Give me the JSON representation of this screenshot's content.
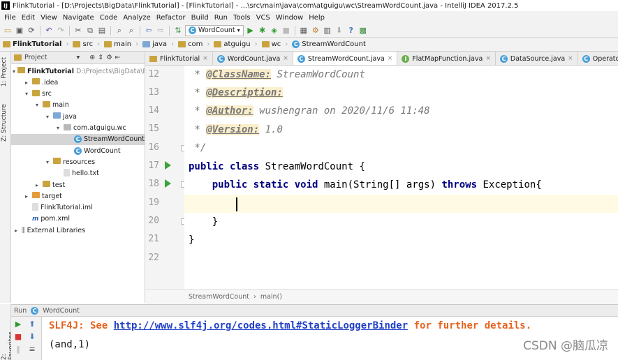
{
  "window": {
    "title": "FlinkTutorial - [D:\\Projects\\BigData\\FlinkTutorial] - [FlinkTutorial] - ...\\src\\main\\java\\com\\atguigu\\wc\\StreamWordCount.java - IntelliJ IDEA 2017.2.5"
  },
  "menu": [
    "File",
    "Edit",
    "View",
    "Navigate",
    "Code",
    "Analyze",
    "Refactor",
    "Build",
    "Run",
    "Tools",
    "VCS",
    "Window",
    "Help"
  ],
  "toolbar": {
    "run_config": "WordCount"
  },
  "breadcrumb": [
    "FlinkTutorial",
    "src",
    "main",
    "java",
    "com",
    "atguigu",
    "wc",
    "StreamWordCount"
  ],
  "side_tabs": {
    "project": "1: Project",
    "structure": "Z: Structure",
    "favorites": "2: Favorites"
  },
  "project_panel": {
    "title": "Project",
    "tree": [
      {
        "label": "FlinkTutorial",
        "suffix": "D:\\Projects\\BigData\\Fli",
        "depth": 0,
        "arrow": "▾",
        "icon": "folder",
        "bold": true
      },
      {
        "label": ".idea",
        "depth": 1,
        "arrow": "▸",
        "icon": "folder"
      },
      {
        "label": "src",
        "depth": 1,
        "arrow": "▾",
        "icon": "folder"
      },
      {
        "label": "main",
        "depth": 2,
        "arrow": "▾",
        "icon": "folder"
      },
      {
        "label": "java",
        "depth": 3,
        "arrow": "▾",
        "icon": "folder-blue"
      },
      {
        "label": "com.atguigu.wc",
        "depth": 4,
        "arrow": "▾",
        "icon": "package"
      },
      {
        "label": "StreamWordCount",
        "depth": 5,
        "arrow": "",
        "icon": "class",
        "selected": true
      },
      {
        "label": "WordCount",
        "depth": 5,
        "arrow": "",
        "icon": "class"
      },
      {
        "label": "resources",
        "depth": 3,
        "arrow": "▾",
        "icon": "folder"
      },
      {
        "label": "hello.txt",
        "depth": 4,
        "arrow": "",
        "icon": "file"
      },
      {
        "label": "test",
        "depth": 2,
        "arrow": "▸",
        "icon": "folder"
      },
      {
        "label": "target",
        "depth": 1,
        "arrow": "▸",
        "icon": "folder-orange"
      },
      {
        "label": "FlinkTutorial.iml",
        "depth": 1,
        "arrow": "",
        "icon": "file"
      },
      {
        "label": "pom.xml",
        "depth": 1,
        "arrow": "",
        "icon": "maven"
      },
      {
        "label": "External Libraries",
        "depth": 0,
        "arrow": "▸",
        "icon": "library"
      }
    ]
  },
  "tabs": [
    {
      "label": "FlinkTutorial",
      "icon": "module"
    },
    {
      "label": "WordCount.java",
      "icon": "class"
    },
    {
      "label": "StreamWordCount.java",
      "icon": "class",
      "active": true
    },
    {
      "label": "FlatMapFunction.java",
      "icon": "interface"
    },
    {
      "label": "DataSource.java",
      "icon": "class"
    },
    {
      "label": "Operator.java",
      "icon": "class"
    }
  ],
  "editor": {
    "line_numbers": [
      "12",
      "13",
      "14",
      "15",
      "16",
      "17",
      "18",
      "19",
      "20",
      "21",
      "22"
    ],
    "lines": {
      "l12_prefix": " * ",
      "l12_tag": "@ClassName:",
      "l12_text": " StreamWordCount",
      "l13_prefix": " * ",
      "l13_tag": "@Description:",
      "l14_prefix": " * ",
      "l14_tag": "@Author:",
      "l14_text": " wushengran on 2020/11/6 11:48",
      "l15_prefix": " * ",
      "l15_tag": "@Version:",
      "l15_text": " 1.0",
      "l16": " */",
      "l17_kw": "public class",
      "l17_text": " StreamWordCount {",
      "l18_kw1": "    public static void",
      "l18_text1": " main(String[] args) ",
      "l18_kw2": "throws",
      "l18_text2": " Exception{",
      "l20": "    }",
      "l21": "}"
    },
    "structure_breadcrumb": [
      "StreamWordCount",
      "main()"
    ]
  },
  "run_panel": {
    "label": "Run",
    "config": "WordCount",
    "console": {
      "l1_prefix": "SLF4J: See ",
      "l1_link": "http://www.slf4j.org/codes.html#StaticLoggerBinder",
      "l1_suffix": " for further details.",
      "l2": "(and,1)"
    }
  },
  "watermark": "CSDN @脑瓜凉"
}
